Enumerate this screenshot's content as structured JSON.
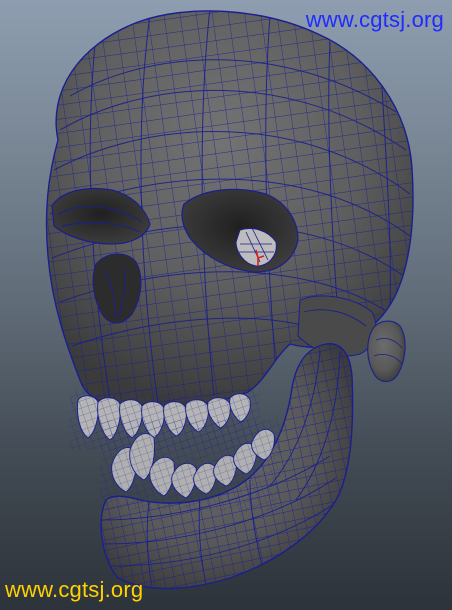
{
  "viewport": {
    "background_top": "#8e9eb0",
    "background_bottom": "#2d333a",
    "model_name": "skull-wireframe-mesh",
    "mesh_shade_color": "#5c5c5c",
    "wire_color": "#1a1f8f",
    "pivot_marker_color": "#d12020"
  },
  "watermarks": {
    "top_text": "www.cgtsj.org",
    "top_color": "#1e2cff",
    "bottom_text": "www.cgtsj.org",
    "bottom_color": "#ffd200"
  }
}
